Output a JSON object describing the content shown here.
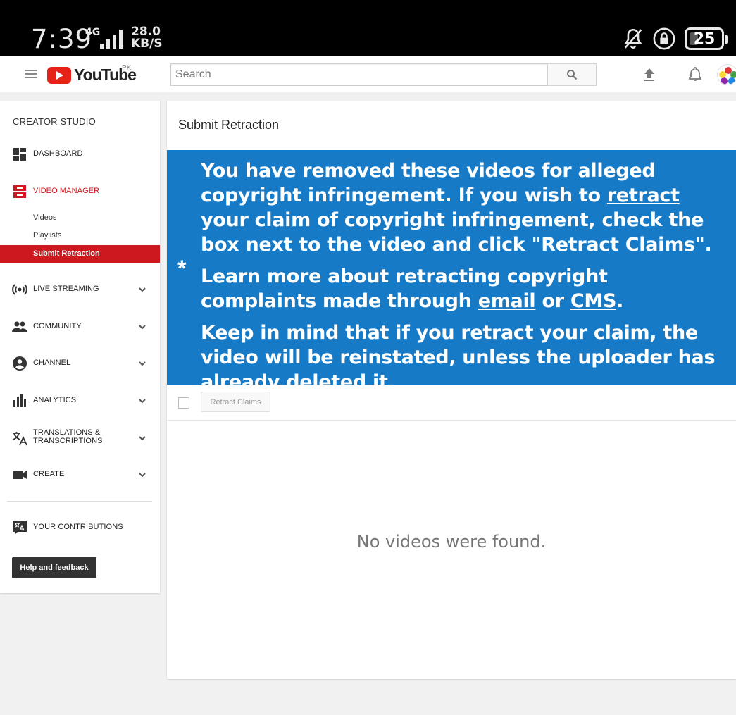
{
  "status_bar": {
    "time": "7:39",
    "network": "4G",
    "speed_value": "28.0",
    "speed_unit": "KB/S",
    "battery": "25"
  },
  "header": {
    "logo_text": "YouTube",
    "region": "PK",
    "search_placeholder": "Search"
  },
  "sidebar": {
    "title": "CREATOR STUDIO",
    "items": [
      {
        "label": "DASHBOARD",
        "icon": "dashboard-icon"
      },
      {
        "label": "VIDEO MANAGER",
        "icon": "video-manager-icon",
        "active": true
      },
      {
        "label": "LIVE STREAMING",
        "icon": "live-streaming-icon"
      },
      {
        "label": "COMMUNITY",
        "icon": "community-icon"
      },
      {
        "label": "CHANNEL",
        "icon": "channel-icon"
      },
      {
        "label": "ANALYTICS",
        "icon": "analytics-icon"
      },
      {
        "label_line1": "TRANSLATIONS &",
        "label_line2": "TRANSCRIPTIONS",
        "icon": "translate-icon"
      },
      {
        "label": "CREATE",
        "icon": "camera-icon"
      },
      {
        "label": "YOUR CONTRIBUTIONS",
        "icon": "contributions-icon"
      }
    ],
    "sub_items": [
      {
        "label": "Videos"
      },
      {
        "label": "Playlists"
      },
      {
        "label": "Submit Retraction",
        "active": true
      }
    ],
    "help_button": "Help and feedback"
  },
  "main": {
    "title": "Submit Retraction",
    "banner": {
      "star": "*",
      "p1_before": "You have removed these videos for alleged copyright infringement. If you wish to ",
      "p1_link": "retract",
      "p1_after": " your claim of copyright infringement, check the box next to the video and click \"Retract Claims\".",
      "p2_before": "Learn more about retracting copyright complaints made through ",
      "p2_link1": "email",
      "p2_mid": " or ",
      "p2_link2": "CMS",
      "p2_after": ".",
      "p3": "Keep in mind that if you retract your claim, the video will be reinstated, unless the uploader has already deleted it."
    },
    "retract_button": "Retract Claims",
    "empty_message": "No videos were found."
  },
  "colors": {
    "accent_red": "#cc181e",
    "banner_blue": "#167ac6"
  }
}
